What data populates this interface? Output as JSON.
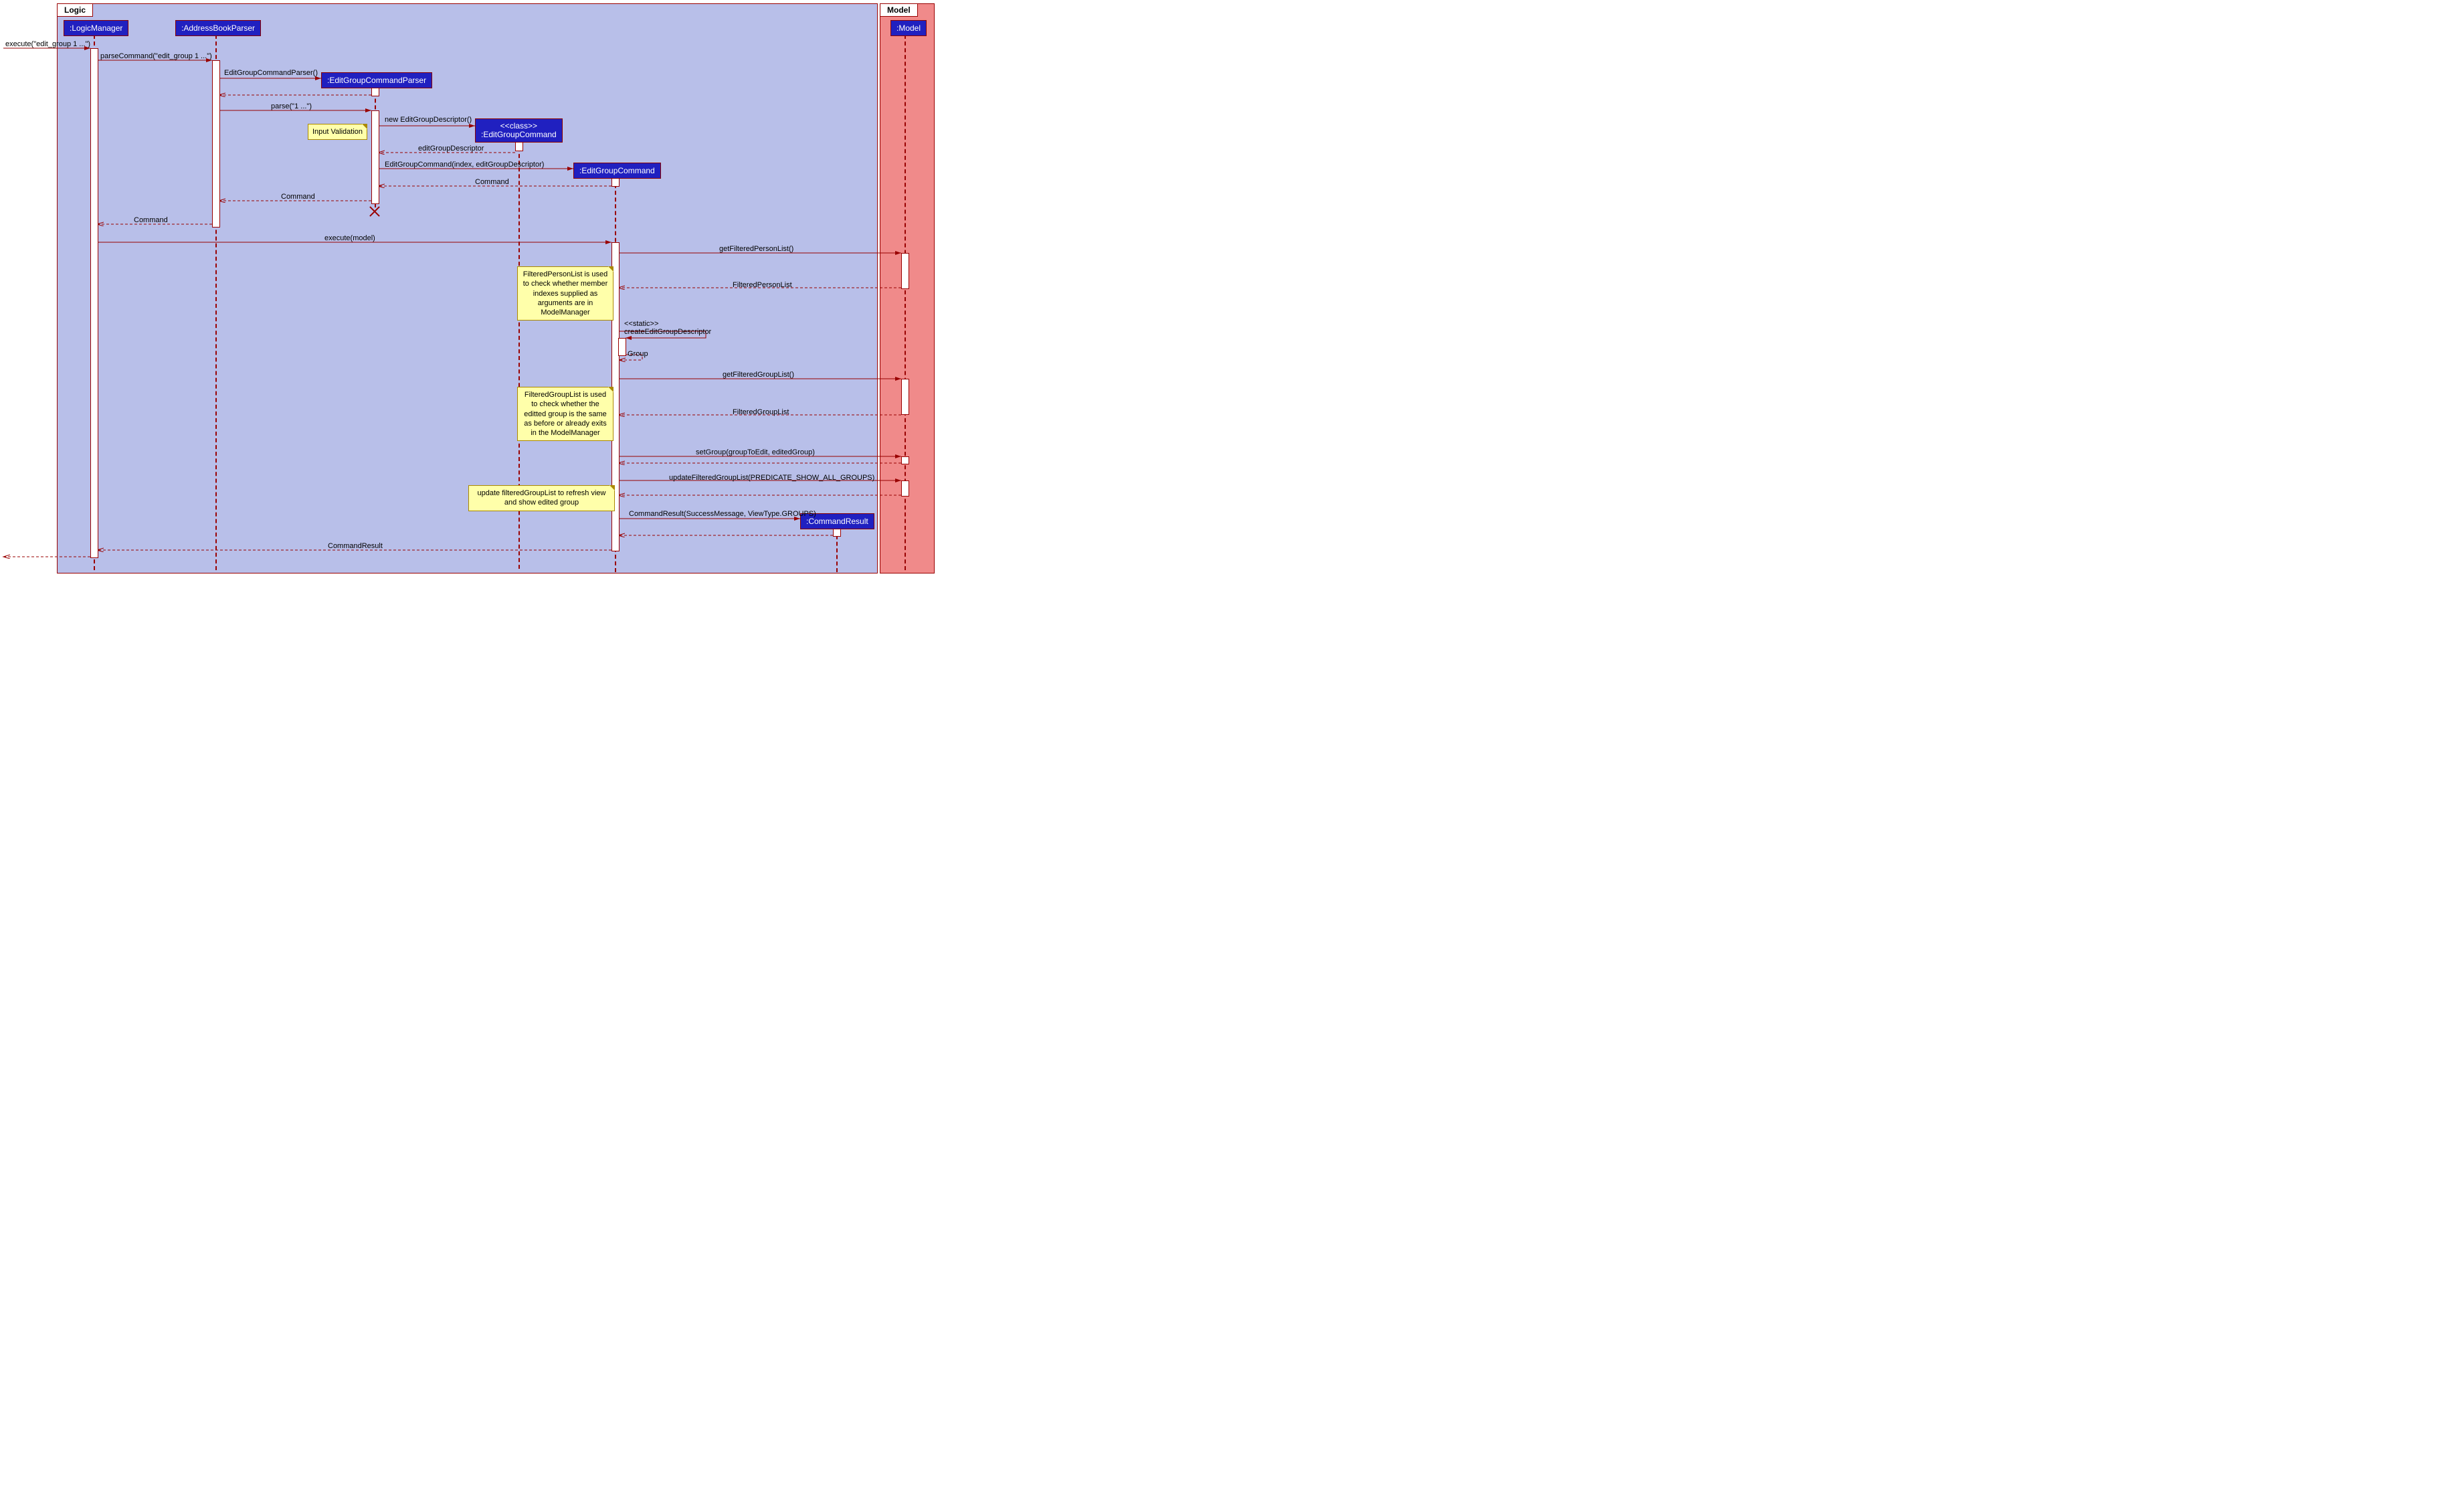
{
  "frames": {
    "logic": "Logic",
    "model": "Model"
  },
  "participants": {
    "logicManager": ":LogicManager",
    "parser": ":AddressBookParser",
    "egcParser": ":EditGroupCommandParser",
    "egcClass1": "<<class>>",
    "egcClass2": ":EditGroupCommand",
    "egc": ":EditGroupCommand",
    "modelP": ":Model",
    "cmdResult": ":CommandResult"
  },
  "messages": {
    "m1": "execute(\"edit_group 1 ...\")",
    "m2": "parseCommand(\"edit_group 1 ...\")",
    "m3": "EditGroupCommandParser()",
    "m4": "parse(\"1 ...\")",
    "m5": "new EditGroupDescriptor()",
    "m6": "editGroupDescriptor",
    "m7": "EditGroupCommand(index, editGroupDescriptor)",
    "m8": "Command",
    "m9": "Command",
    "m10": "Command",
    "m11": "execute(model)",
    "m12": "getFilteredPersonList()",
    "m13": "FilteredPersonList",
    "m14a": "<<static>>",
    "m14b": "createEditGroupDescriptor",
    "m15": "Group",
    "m16": "getFilteredGroupList()",
    "m17": "FilteredGroupList",
    "m18": "setGroup(groupToEdit, editedGroup)",
    "m19": "updateFilteredGroupList(PREDICATE_SHOW_ALL_GROUPS)",
    "m20": "CommandResult(SuccessMessage, ViewType.GROUPS)",
    "m21": "CommandResult"
  },
  "notes": {
    "n1": "Input Validation",
    "n2": "FilteredPersonList is used to check whether member indexes supplied as arguments are in ModelManager",
    "n3": "FilteredGroupList is used to check whether the editted group is the same as before or already exits in the ModelManager",
    "n4": "update filteredGroupList to refresh view and show edited group"
  },
  "chart_data": {
    "type": "sequence_diagram",
    "frames": [
      "Logic",
      "Model"
    ],
    "participants": [
      {
        "name": ":LogicManager",
        "frame": "Logic"
      },
      {
        "name": ":AddressBookParser",
        "frame": "Logic"
      },
      {
        "name": ":EditGroupCommandParser",
        "frame": "Logic",
        "created": true,
        "destroyed": true
      },
      {
        "name": "<<class>> :EditGroupCommand",
        "frame": "Logic",
        "created": true
      },
      {
        "name": ":EditGroupCommand",
        "frame": "Logic",
        "created": true
      },
      {
        "name": ":CommandResult",
        "frame": "Logic",
        "created": true
      },
      {
        "name": ":Model",
        "frame": "Model"
      }
    ],
    "messages": [
      {
        "from": "(external)",
        "to": ":LogicManager",
        "label": "execute(\"edit_group 1 ...\")",
        "type": "sync"
      },
      {
        "from": ":LogicManager",
        "to": ":AddressBookParser",
        "label": "parseCommand(\"edit_group 1 ...\")",
        "type": "sync"
      },
      {
        "from": ":AddressBookParser",
        "to": ":EditGroupCommandParser",
        "label": "EditGroupCommandParser()",
        "type": "create"
      },
      {
        "from": ":EditGroupCommandParser",
        "to": ":AddressBookParser",
        "label": "",
        "type": "return"
      },
      {
        "from": ":AddressBookParser",
        "to": ":EditGroupCommandParser",
        "label": "parse(\"1 ...\")",
        "type": "sync"
      },
      {
        "from": ":EditGroupCommandParser",
        "to": "<<class>> :EditGroupCommand",
        "label": "new EditGroupDescriptor()",
        "type": "create",
        "note": "Input Validation"
      },
      {
        "from": "<<class>> :EditGroupCommand",
        "to": ":EditGroupCommandParser",
        "label": "editGroupDescriptor",
        "type": "return"
      },
      {
        "from": ":EditGroupCommandParser",
        "to": ":EditGroupCommand",
        "label": "EditGroupCommand(index, editGroupDescriptor)",
        "type": "create"
      },
      {
        "from": ":EditGroupCommand",
        "to": ":EditGroupCommandParser",
        "label": "Command",
        "type": "return"
      },
      {
        "from": ":EditGroupCommandParser",
        "to": ":AddressBookParser",
        "label": "Command",
        "type": "return"
      },
      {
        "from": ":AddressBookParser",
        "to": ":LogicManager",
        "label": "Command",
        "type": "return"
      },
      {
        "from": ":LogicManager",
        "to": ":EditGroupCommand",
        "label": "execute(model)",
        "type": "sync"
      },
      {
        "from": ":EditGroupCommand",
        "to": ":Model",
        "label": "getFilteredPersonList()",
        "type": "sync"
      },
      {
        "from": ":Model",
        "to": ":EditGroupCommand",
        "label": "FilteredPersonList",
        "type": "return",
        "note": "FilteredPersonList is used to check whether member indexes supplied as arguments are in ModelManager"
      },
      {
        "from": ":EditGroupCommand",
        "to": ":EditGroupCommand",
        "label": "<<static>> createEditGroupDescriptor",
        "type": "self"
      },
      {
        "from": ":EditGroupCommand",
        "to": ":EditGroupCommand",
        "label": "Group",
        "type": "return-self"
      },
      {
        "from": ":EditGroupCommand",
        "to": ":Model",
        "label": "getFilteredGroupList()",
        "type": "sync"
      },
      {
        "from": ":Model",
        "to": ":EditGroupCommand",
        "label": "FilteredGroupList",
        "type": "return",
        "note": "FilteredGroupList is used to check whether the editted group is the same as before or already exits in the ModelManager"
      },
      {
        "from": ":EditGroupCommand",
        "to": ":Model",
        "label": "setGroup(groupToEdit, editedGroup)",
        "type": "sync"
      },
      {
        "from": ":Model",
        "to": ":EditGroupCommand",
        "label": "",
        "type": "return"
      },
      {
        "from": ":EditGroupCommand",
        "to": ":Model",
        "label": "updateFilteredGroupList(PREDICATE_SHOW_ALL_GROUPS)",
        "type": "sync",
        "note": "update filteredGroupList to refresh view and show edited group"
      },
      {
        "from": ":Model",
        "to": ":EditGroupCommand",
        "label": "",
        "type": "return"
      },
      {
        "from": ":EditGroupCommand",
        "to": ":CommandResult",
        "label": "CommandResult(SuccessMessage, ViewType.GROUPS)",
        "type": "create"
      },
      {
        "from": ":CommandResult",
        "to": ":EditGroupCommand",
        "label": "",
        "type": "return"
      },
      {
        "from": ":EditGroupCommand",
        "to": ":LogicManager",
        "label": "CommandResult",
        "type": "return"
      },
      {
        "from": ":LogicManager",
        "to": "(external)",
        "label": "",
        "type": "return"
      }
    ]
  }
}
